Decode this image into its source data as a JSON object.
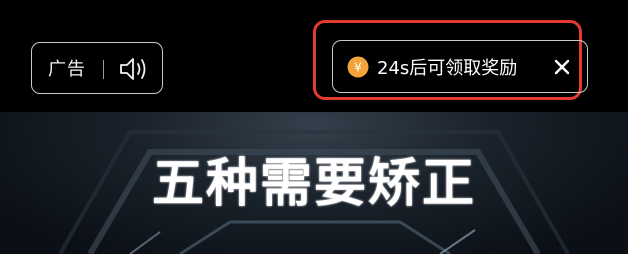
{
  "ad_badge": {
    "label": "广告",
    "icon": "speaker-icon"
  },
  "reward": {
    "icon": "coin-icon",
    "coin_symbol": "¥",
    "text": "24s后可领取奖励",
    "close_icon": "close-icon"
  },
  "video": {
    "title": "五种需要矫正"
  },
  "colors": {
    "highlight": "#e43b31",
    "coin": "#f2a33a",
    "background": "#000000"
  }
}
